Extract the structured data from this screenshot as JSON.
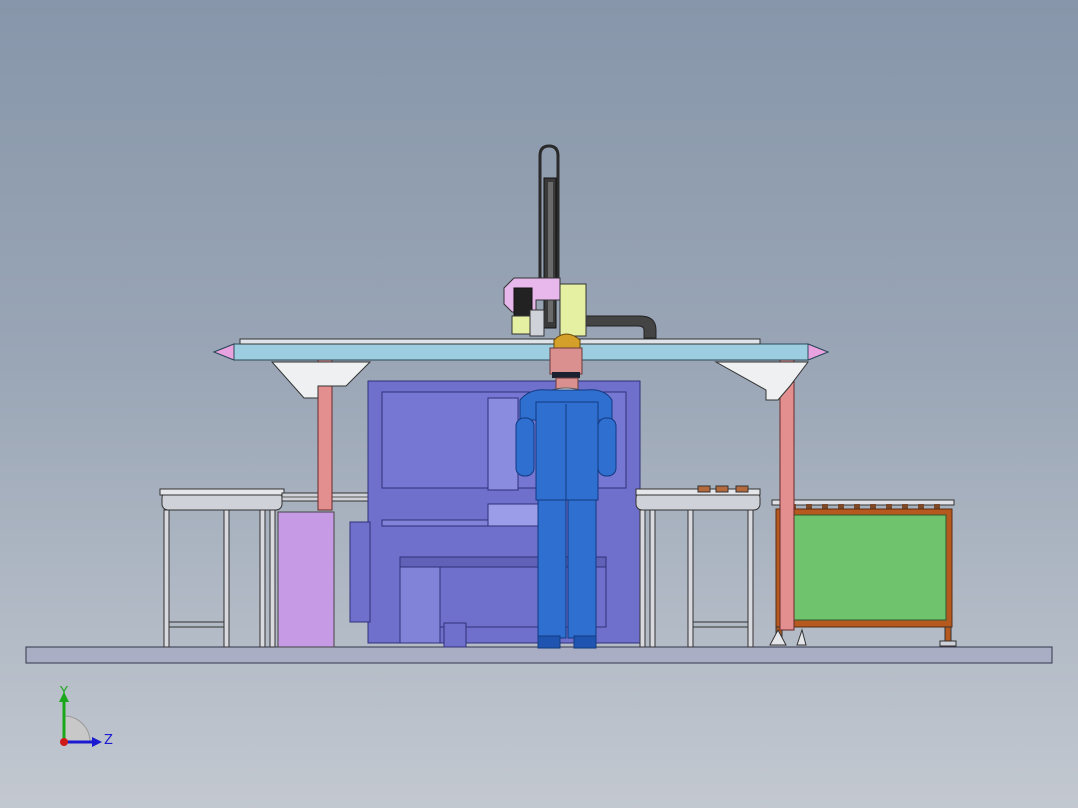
{
  "viewport": {
    "background_top": "#8796aa",
    "background_bottom": "#c3c8d0"
  },
  "triad": {
    "y_label": "Y",
    "z_label": "Z",
    "y_color": "#1aa81a",
    "z_color": "#1a1ad0",
    "x_color": "#d01a1a"
  },
  "colors": {
    "beam": "#9ccde0",
    "beam_end_caps": "#e9a2e0",
    "posts": "#e38f8f",
    "machine": "#6f70cc",
    "person_suit": "#2f6fd0",
    "person_head": "#d9908e",
    "helmet": "#d4a02a",
    "cabinet_panel": "#6ec36c",
    "cabinet_frame": "#b5591e",
    "purple_panel": "#c79ae6",
    "gripper_pink": "#e8b8ec",
    "gripper_yellow": "#e5f0a2",
    "base_plate": "#a9aec5"
  }
}
